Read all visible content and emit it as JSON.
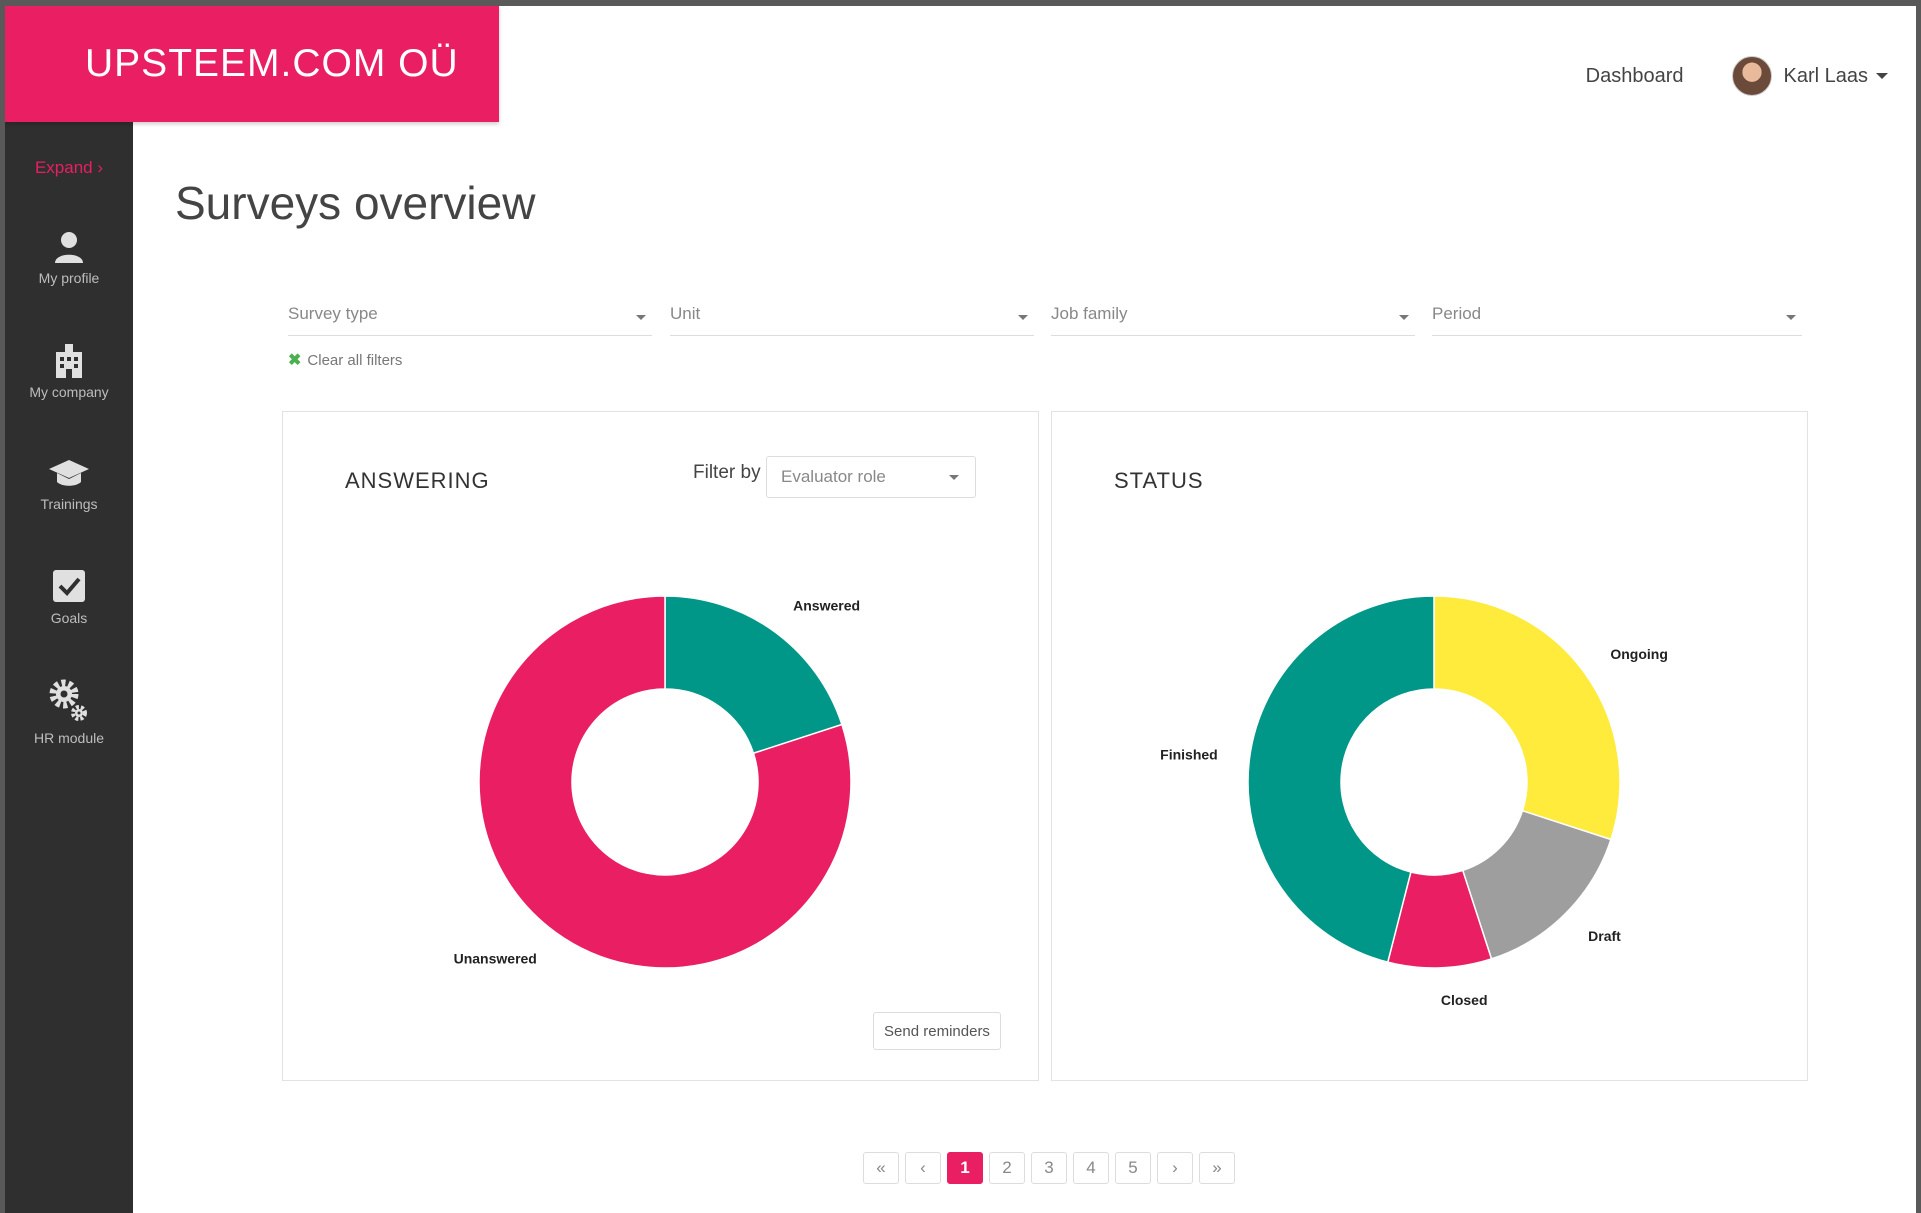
{
  "brand": {
    "name": "UPSTEEM.COM OÜ",
    "color": "#e91e63"
  },
  "topnav": {
    "dashboard": "Dashboard",
    "user_name": "Karl Laas"
  },
  "sidebar": {
    "expand": "Expand ›",
    "items": [
      {
        "label": "My profile",
        "icon": "person-icon"
      },
      {
        "label": "My company",
        "icon": "building-icon"
      },
      {
        "label": "Trainings",
        "icon": "graduation-cap-icon"
      },
      {
        "label": "Goals",
        "icon": "checkbox-icon"
      },
      {
        "label": "HR module",
        "icon": "gears-icon"
      }
    ]
  },
  "page": {
    "title": "Surveys overview"
  },
  "filters": {
    "survey_type": "Survey type",
    "unit": "Unit",
    "job_family": "Job family",
    "period": "Period",
    "clear": "Clear all filters"
  },
  "answering_card": {
    "title": "ANSWERING",
    "filter_by": "Filter by",
    "evaluator_role": "Evaluator role",
    "send_reminders": "Send reminders"
  },
  "status_card": {
    "title": "STATUS"
  },
  "chart_data": [
    {
      "type": "pie",
      "title": "ANSWERING",
      "donut": true,
      "categories": [
        "Answered",
        "Unanswered"
      ],
      "values": [
        20,
        80
      ],
      "colors": [
        "#009688",
        "#e91e63"
      ]
    },
    {
      "type": "pie",
      "title": "STATUS",
      "donut": true,
      "categories": [
        "Ongoing",
        "Draft",
        "Closed",
        "Finished"
      ],
      "values": [
        30,
        15,
        9,
        46
      ],
      "colors": [
        "#ffeb3b",
        "#9e9e9e",
        "#e91e63",
        "#009688"
      ]
    }
  ],
  "pagination": {
    "first": "«",
    "prev": "‹",
    "pages": [
      "1",
      "2",
      "3",
      "4",
      "5"
    ],
    "active": "1",
    "next": "›",
    "last": "»"
  }
}
